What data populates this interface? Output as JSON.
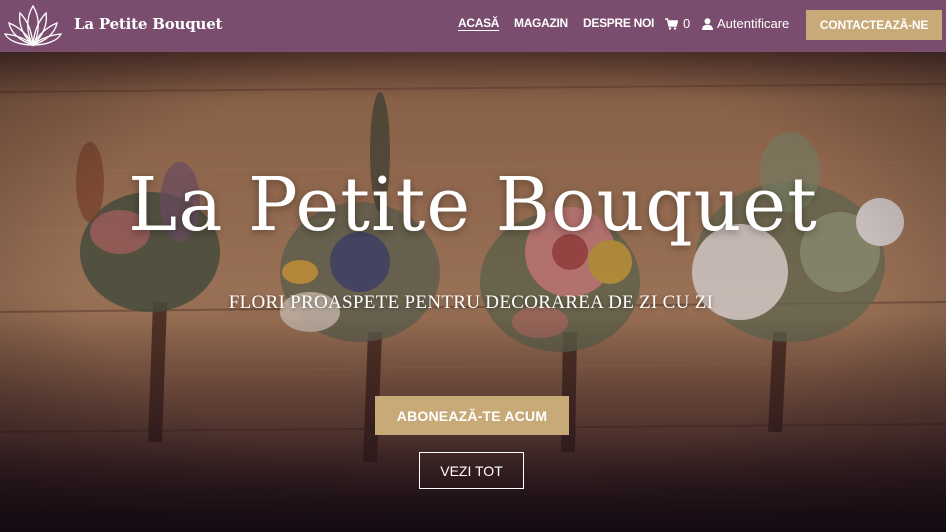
{
  "header": {
    "brand": "La Petite Bouquet",
    "nav": [
      "ACASĂ",
      "MAGAZIN",
      "DESPRE NOI"
    ],
    "cart_count": "0",
    "login_label": "Autentificare",
    "contact_label": "CONTACTEAZĂ-NE"
  },
  "hero": {
    "title": "La Petite Bouquet",
    "subtitle": "FLORI PROASPETE PENTRU DECORAREA DE ZI CU ZI",
    "subscribe_label": "ABONEAZĂ-TE ACUM",
    "see_all_label": "VEZI TOT"
  },
  "colors": {
    "header_bg": "#7a4c6e",
    "accent_gold": "#c8a978",
    "text": "#ffffff"
  },
  "icons": [
    "lotus-logo-icon",
    "cart-icon",
    "user-icon"
  ]
}
